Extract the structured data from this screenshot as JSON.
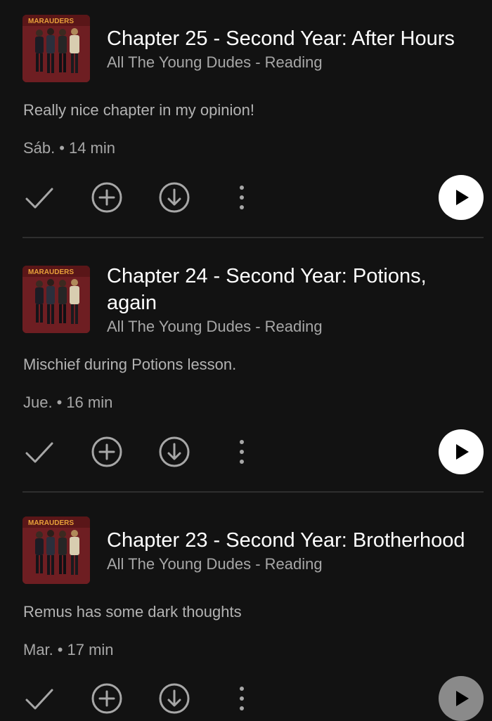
{
  "colors": {
    "background": "#121212",
    "title": "#ffffff",
    "secondary_text": "#a7a7a7",
    "play_button": "#ffffff",
    "divider": "#2e2e2e",
    "cover_red": "#6e1e22"
  },
  "icons": {
    "mark_played": "check-icon",
    "add": "plus-circle-icon",
    "download": "download-circle-icon",
    "more": "more-vertical-icon",
    "play": "play-icon"
  },
  "episodes": [
    {
      "title": "Chapter 25 - Second Year: After Hours",
      "show": "All The Young Dudes - Reading",
      "description": "Really nice chapter in my opinion!",
      "day": "Sáb.",
      "separator": "•",
      "duration": "14 min"
    },
    {
      "title": "Chapter 24 - Second Year: Potions, again",
      "show": "All The Young Dudes - Reading",
      "description": "Mischief during Potions lesson.",
      "day": "Jue.",
      "separator": "•",
      "duration": "16 min"
    },
    {
      "title": "Chapter 23 - Second Year: Brotherhood",
      "show": "All The Young Dudes - Reading",
      "description": "Remus has some dark thoughts",
      "day": "Mar.",
      "separator": "•",
      "duration": "17 min"
    }
  ]
}
